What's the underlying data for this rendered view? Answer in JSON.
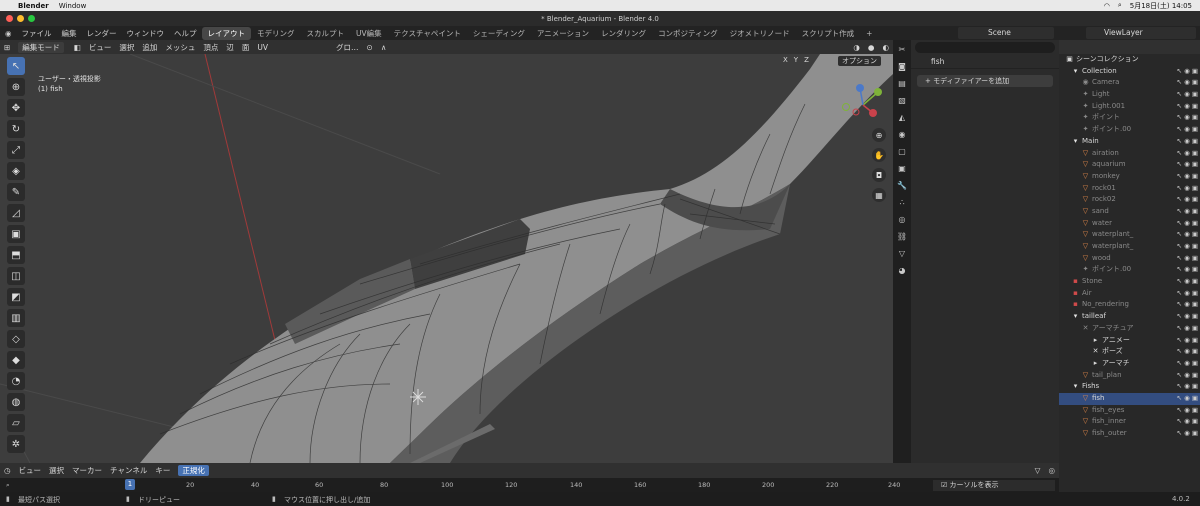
{
  "mac_menu": {
    "app": "Blender",
    "window": "Window",
    "date": "5月18日(土) 14:05"
  },
  "window_title": "* Blender_Aquarium - Blender 4.0",
  "top_menu": [
    "ファイル",
    "編集",
    "レンダー",
    "ウィンドウ",
    "ヘルプ"
  ],
  "workspaces": [
    {
      "label": "レイアウト",
      "active": true
    },
    {
      "label": "モデリング"
    },
    {
      "label": "スカルプト"
    },
    {
      "label": "UV編集"
    },
    {
      "label": "テクスチャペイント"
    },
    {
      "label": "シェーディング"
    },
    {
      "label": "アニメーション"
    },
    {
      "label": "レンダリング"
    },
    {
      "label": "コンポジティング"
    },
    {
      "label": "ジオメトリノード"
    },
    {
      "label": "スクリプト作成"
    }
  ],
  "scene_name": "Scene",
  "view_layer": "ViewLayer",
  "viewport_header": {
    "mode": "編集モード",
    "menus": [
      "ビュー",
      "選択",
      "追加",
      "メッシュ",
      "頂点",
      "辺",
      "面",
      "UV"
    ],
    "transform": "グロ…",
    "axes": [
      "X",
      "Y",
      "Z"
    ],
    "options": "オプション"
  },
  "viewport_info": {
    "line1": "ユーザー・透視投影",
    "line2": "(1) fish"
  },
  "properties": {
    "object": "fish",
    "add_modifier": "モディファイアーを追加"
  },
  "outliner": {
    "title": "シーンコレクション",
    "rows": [
      {
        "indent": 1,
        "icon": "▾",
        "label": "Collection",
        "type": "collection"
      },
      {
        "indent": 2,
        "icon": "◉",
        "label": "Camera",
        "dim": true
      },
      {
        "indent": 2,
        "icon": "✦",
        "label": "Light",
        "dim": true
      },
      {
        "indent": 2,
        "icon": "✦",
        "label": "Light.001",
        "dim": true
      },
      {
        "indent": 2,
        "icon": "✦",
        "label": "ポイント",
        "dim": true
      },
      {
        "indent": 2,
        "icon": "✦",
        "label": "ポイント.00",
        "dim": true
      },
      {
        "indent": 1,
        "icon": "▾",
        "label": "Main",
        "type": "collection"
      },
      {
        "indent": 2,
        "icon": "▽",
        "label": "airation",
        "dim": true
      },
      {
        "indent": 2,
        "icon": "▽",
        "label": "aquarium",
        "dim": true
      },
      {
        "indent": 2,
        "icon": "▽",
        "label": "monkey",
        "dim": true
      },
      {
        "indent": 2,
        "icon": "▽",
        "label": "rock01",
        "dim": true
      },
      {
        "indent": 2,
        "icon": "▽",
        "label": "rock02",
        "dim": true
      },
      {
        "indent": 2,
        "icon": "▽",
        "label": "sand",
        "dim": true
      },
      {
        "indent": 2,
        "icon": "▽",
        "label": "water",
        "dim": true
      },
      {
        "indent": 2,
        "icon": "▽",
        "label": "waterplant_",
        "dim": true
      },
      {
        "indent": 2,
        "icon": "▽",
        "label": "waterplant_",
        "dim": true
      },
      {
        "indent": 2,
        "icon": "▽",
        "label": "wood",
        "dim": true
      },
      {
        "indent": 2,
        "icon": "✦",
        "label": "ポイント.00",
        "dim": true
      },
      {
        "indent": 1,
        "icon": "▪",
        "label": "Stone",
        "dim": true
      },
      {
        "indent": 1,
        "icon": "▪",
        "label": "Air",
        "dim": true
      },
      {
        "indent": 1,
        "icon": "▪",
        "label": "No_rendering",
        "dim": true
      },
      {
        "indent": 1,
        "icon": "▾",
        "label": "tailleaf",
        "type": "collection"
      },
      {
        "indent": 2,
        "icon": "✕",
        "label": "アーマチュア",
        "dim": true
      },
      {
        "indent": 3,
        "icon": "▸",
        "label": "アニメー"
      },
      {
        "indent": 3,
        "icon": "✕",
        "label": "ポーズ"
      },
      {
        "indent": 3,
        "icon": "▸",
        "label": "アーマチ"
      },
      {
        "indent": 2,
        "icon": "▽",
        "label": "tail_plan",
        "dim": true
      },
      {
        "indent": 1,
        "icon": "▾",
        "label": "Fishs",
        "type": "collection"
      },
      {
        "indent": 2,
        "icon": "▽",
        "label": "fish",
        "selected": true
      },
      {
        "indent": 2,
        "icon": "▽",
        "label": "fish_eyes",
        "dim": true
      },
      {
        "indent": 2,
        "icon": "▽",
        "label": "fish_inner",
        "dim": true
      },
      {
        "indent": 2,
        "icon": "▽",
        "label": "fish_outer",
        "dim": true
      }
    ]
  },
  "timeline": {
    "menus": [
      "ビュー",
      "選択",
      "マーカー",
      "チャンネル",
      "キー"
    ],
    "normalize": "正規化",
    "current_frame": "1",
    "ticks": [
      "20",
      "40",
      "60",
      "80",
      "100",
      "120",
      "140",
      "160",
      "180",
      "200",
      "220",
      "240"
    ],
    "show_cursor": "カーソルを表示"
  },
  "status_bar": {
    "left": "最短パス選択",
    "middle": "ドリーピュー",
    "right": "マウス位置に押し出し/追加",
    "version": "4.0.2"
  },
  "colors": {
    "accent": "#4772b3",
    "viewport_bg": "#3d3d3d",
    "selected_row": "#334d80"
  }
}
